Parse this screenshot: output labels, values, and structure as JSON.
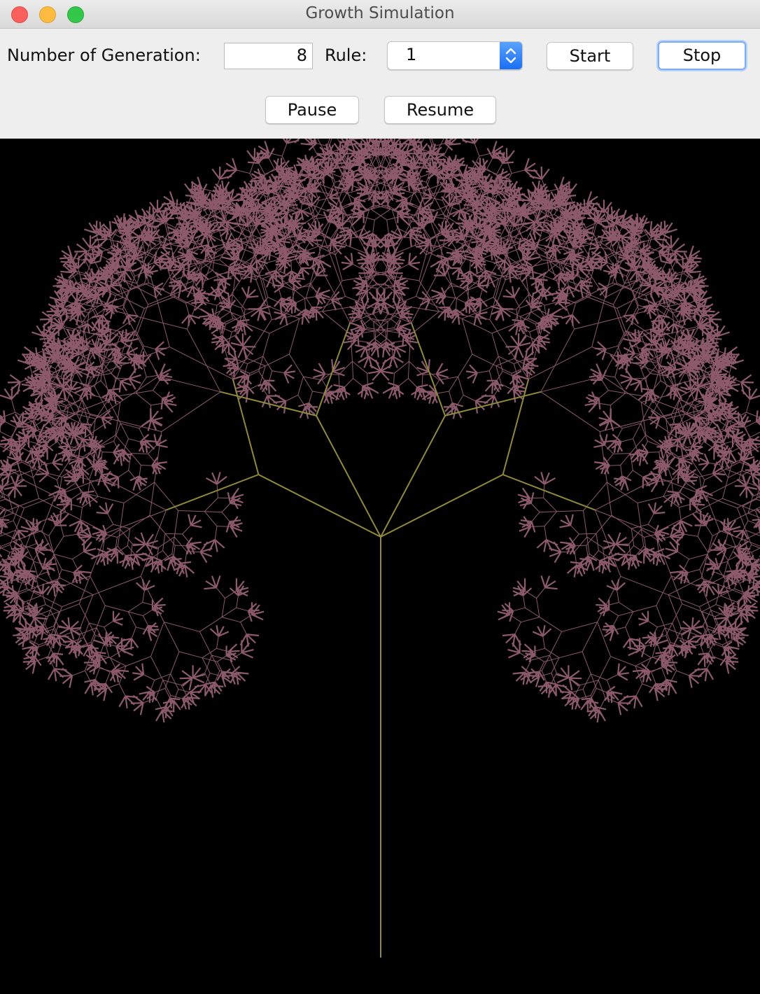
{
  "window": {
    "title": "Growth Simulation"
  },
  "controls": {
    "generation_label": "Number of Generation:",
    "generation_value": "8",
    "rule_label": "Rule:",
    "rule_selected": "1",
    "start_label": "Start",
    "stop_label": "Stop",
    "pause_label": "Pause",
    "resume_label": "Resume"
  },
  "canvas": {
    "background": "#000000",
    "branch_color": "#8f8a3d",
    "leaf_color": "#8c5a6a",
    "generations": 8
  }
}
